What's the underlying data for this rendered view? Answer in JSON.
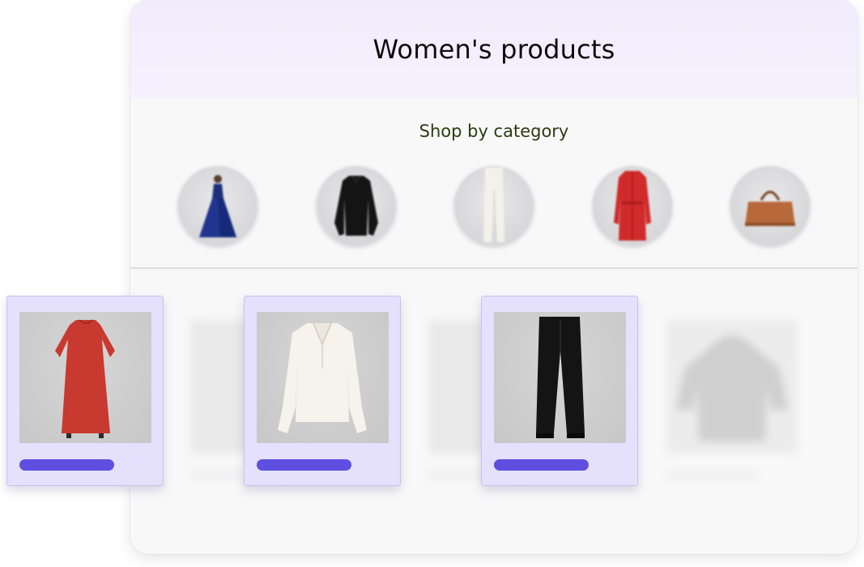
{
  "page": {
    "title": "Women's products",
    "section_title": "Shop by category"
  },
  "categories": [
    {
      "name": "dress-category",
      "icon": "blue-gown-icon"
    },
    {
      "name": "tops-category",
      "icon": "black-shirt-icon"
    },
    {
      "name": "pants-category",
      "icon": "white-trousers-icon"
    },
    {
      "name": "coats-category",
      "icon": "red-coat-icon"
    },
    {
      "name": "bags-category",
      "icon": "brown-handbag-icon"
    }
  ],
  "products": [
    {
      "name": "red-dress",
      "icon": "red-dress-icon"
    },
    {
      "name": "white-blouse",
      "icon": "white-blouse-icon"
    },
    {
      "name": "black-trousers",
      "icon": "black-trousers-icon"
    }
  ],
  "colors": {
    "accent": "#5f4fe0",
    "card_bg": "#e5e0fb",
    "header_bg": "#f1ecfc"
  }
}
